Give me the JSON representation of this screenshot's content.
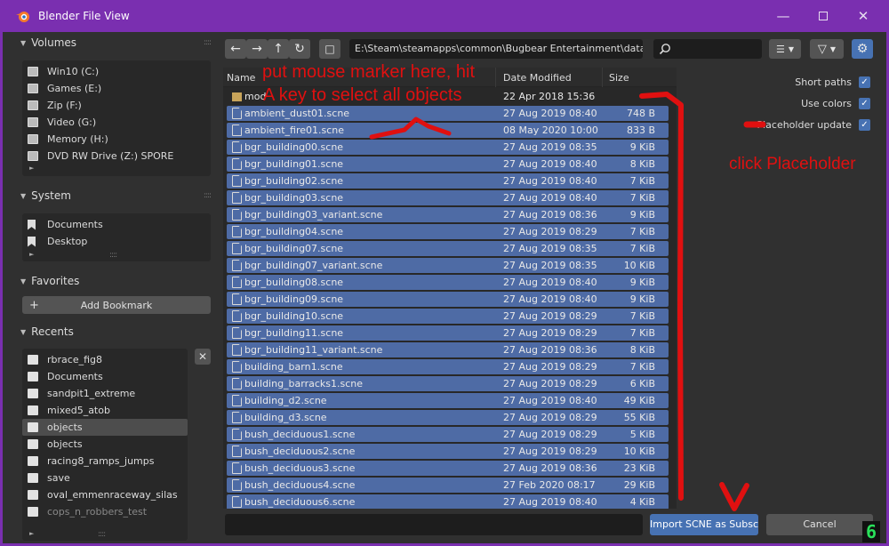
{
  "window": {
    "title": "Blender File View",
    "minimize_icon": "minimize-icon",
    "maximize_icon": "maximize-icon",
    "close_icon": "close-icon"
  },
  "sidebar": {
    "volumes": {
      "title": "Volumes",
      "items": [
        "Win10 (C:)",
        "Games (E:)",
        "Zip (F:)",
        "Video (G:)",
        "Memory (H:)",
        "DVD RW Drive (Z:) SPORE"
      ]
    },
    "system": {
      "title": "System",
      "items": [
        "Documents",
        "Desktop"
      ]
    },
    "favorites": {
      "title": "Favorites",
      "add_bookmark": "Add Bookmark"
    },
    "recents": {
      "title": "Recents",
      "clear_icon": "x-icon",
      "items": [
        "rbrace_fig8",
        "Documents",
        "sandpit1_extreme",
        "mixed5_atob",
        "objects",
        "objects",
        "racing8_ramps_jumps",
        "save",
        "oval_emmenraceway_silas",
        "cops_n_robbers_test"
      ],
      "selected_index": 4
    }
  },
  "toolbar": {
    "path": "E:\\Steam\\steamapps\\common\\Bugbear Entertainment\\data\\art\\obj...",
    "search_value": "",
    "accent_color": "#4772b3"
  },
  "columns": {
    "name": "Name",
    "date": "Date Modified",
    "size": "Size"
  },
  "files": [
    {
      "name": "mod",
      "date": "22 Apr 2018 15:36",
      "size": "",
      "type": "folder",
      "selected": false
    },
    {
      "name": "ambient_dust01.scne",
      "date": "27 Aug 2019 08:40",
      "size": "748 B",
      "type": "file",
      "selected": true
    },
    {
      "name": "ambient_fire01.scne",
      "date": "08 May 2020 10:00",
      "size": "833 B",
      "type": "file",
      "selected": true
    },
    {
      "name": "bgr_building00.scne",
      "date": "27 Aug 2019 08:35",
      "size": "9 KiB",
      "type": "file",
      "selected": true
    },
    {
      "name": "bgr_building01.scne",
      "date": "27 Aug 2019 08:40",
      "size": "8 KiB",
      "type": "file",
      "selected": true
    },
    {
      "name": "bgr_building02.scne",
      "date": "27 Aug 2019 08:40",
      "size": "7 KiB",
      "type": "file",
      "selected": true
    },
    {
      "name": "bgr_building03.scne",
      "date": "27 Aug 2019 08:40",
      "size": "7 KiB",
      "type": "file",
      "selected": true
    },
    {
      "name": "bgr_building03_variant.scne",
      "date": "27 Aug 2019 08:36",
      "size": "9 KiB",
      "type": "file",
      "selected": true
    },
    {
      "name": "bgr_building04.scne",
      "date": "27 Aug 2019 08:29",
      "size": "7 KiB",
      "type": "file",
      "selected": true
    },
    {
      "name": "bgr_building07.scne",
      "date": "27 Aug 2019 08:35",
      "size": "7 KiB",
      "type": "file",
      "selected": true
    },
    {
      "name": "bgr_building07_variant.scne",
      "date": "27 Aug 2019 08:35",
      "size": "10 KiB",
      "type": "file",
      "selected": true
    },
    {
      "name": "bgr_building08.scne",
      "date": "27 Aug 2019 08:40",
      "size": "9 KiB",
      "type": "file",
      "selected": true
    },
    {
      "name": "bgr_building09.scne",
      "date": "27 Aug 2019 08:40",
      "size": "9 KiB",
      "type": "file",
      "selected": true
    },
    {
      "name": "bgr_building10.scne",
      "date": "27 Aug 2019 08:29",
      "size": "7 KiB",
      "type": "file",
      "selected": true
    },
    {
      "name": "bgr_building11.scne",
      "date": "27 Aug 2019 08:29",
      "size": "7 KiB",
      "type": "file",
      "selected": true
    },
    {
      "name": "bgr_building11_variant.scne",
      "date": "27 Aug 2019 08:36",
      "size": "8 KiB",
      "type": "file",
      "selected": true
    },
    {
      "name": "building_barn1.scne",
      "date": "27 Aug 2019 08:29",
      "size": "7 KiB",
      "type": "file",
      "selected": true
    },
    {
      "name": "building_barracks1.scne",
      "date": "27 Aug 2019 08:29",
      "size": "6 KiB",
      "type": "file",
      "selected": true
    },
    {
      "name": "building_d2.scne",
      "date": "27 Aug 2019 08:40",
      "size": "49 KiB",
      "type": "file",
      "selected": true
    },
    {
      "name": "building_d3.scne",
      "date": "27 Aug 2019 08:29",
      "size": "55 KiB",
      "type": "file",
      "selected": true
    },
    {
      "name": "bush_deciduous1.scne",
      "date": "27 Aug 2019 08:29",
      "size": "5 KiB",
      "type": "file",
      "selected": true
    },
    {
      "name": "bush_deciduous2.scne",
      "date": "27 Aug 2019 08:29",
      "size": "10 KiB",
      "type": "file",
      "selected": true
    },
    {
      "name": "bush_deciduous3.scne",
      "date": "27 Aug 2019 08:36",
      "size": "23 KiB",
      "type": "file",
      "selected": true
    },
    {
      "name": "bush_deciduous4.scne",
      "date": "27 Feb 2020 08:17",
      "size": "29 KiB",
      "type": "file",
      "selected": true
    },
    {
      "name": "bush_deciduous6.scne",
      "date": "27 Aug 2019 08:40",
      "size": "4 KiB",
      "type": "file",
      "selected": true
    }
  ],
  "options": {
    "short_paths": "Short paths",
    "use_colors": "Use colors",
    "placeholder_update": "Placeholder update"
  },
  "bottom": {
    "filename_value": "",
    "import_label": "Import SCNE as Subsce...",
    "cancel_label": "Cancel",
    "badge": "6"
  },
  "annotations": {
    "instruction_line1": "put mouse marker here, hit",
    "instruction_line2": "A key to select all objects",
    "instruction_right": "click Placeholder",
    "annotation_color": "#e01010"
  }
}
